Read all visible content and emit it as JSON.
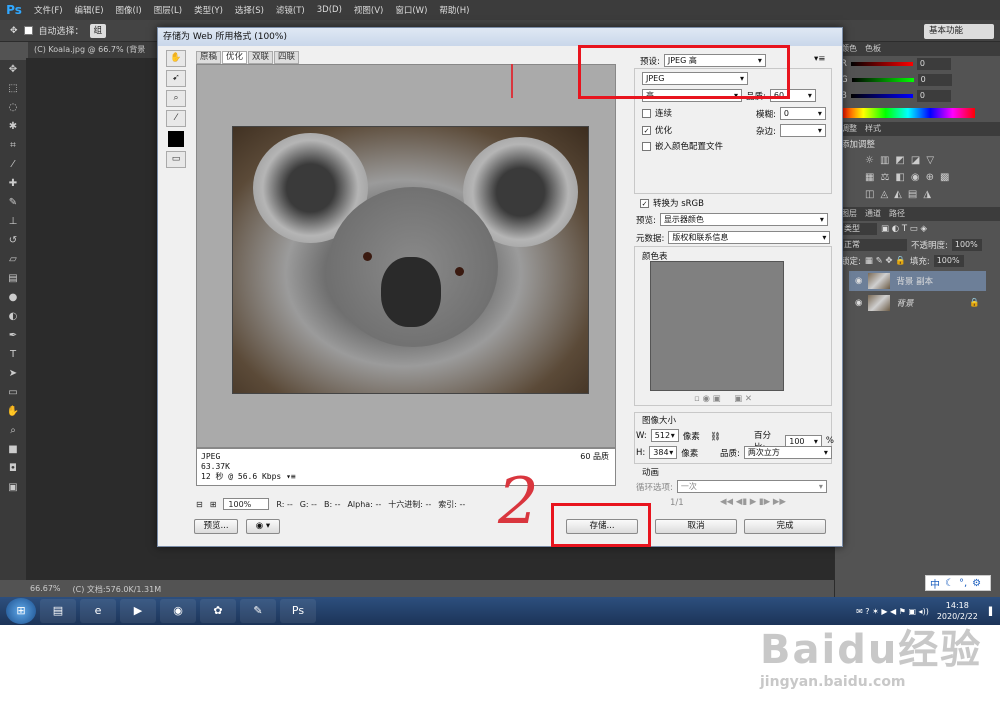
{
  "app": {
    "logo": "Ps"
  },
  "menu": [
    "文件(F)",
    "编辑(E)",
    "图像(I)",
    "图层(L)",
    "类型(Y)",
    "选择(S)",
    "滤镜(T)",
    "3D(D)",
    "视图(V)",
    "窗口(W)",
    "帮助(H)"
  ],
  "options_bar": {
    "auto_select_label": "自动选择：",
    "auto_select_value": "组",
    "workspace": "基本功能"
  },
  "doc_tab": "(C) Koala.jpg @ 66.7% (背景 副...",
  "status": {
    "zoom": "66.67%",
    "doc": "(C) 文档:576.0K/1.31M"
  },
  "dialog": {
    "title": "存储为 Web 所用格式 (100%)",
    "view_tabs": [
      "原稿",
      "优化",
      "双联",
      "四联"
    ],
    "active_tab": "优化",
    "preview_info": {
      "format": "JPEG",
      "size": "63.37K",
      "time": "12 秒 @ 56.6 Kbps",
      "menu_glyph": "▾≡",
      "quality": "60 品质"
    },
    "bottom_bar": {
      "zoom": "100%",
      "r": "R: --",
      "g": "G: --",
      "b": "B: --",
      "alpha": "Alpha: --",
      "hex": "十六进制: --",
      "index": "索引: --"
    },
    "buttons": {
      "preview": "预览...",
      "save": "存储...",
      "cancel": "取消",
      "done": "完成"
    },
    "settings": {
      "preset_label": "预设:",
      "preset_value": "JPEG 高",
      "format": "JPEG",
      "quality_level": "高",
      "quality_label": "品质:",
      "quality_value": "60",
      "progressive": "连续",
      "blur_label": "模糊:",
      "blur_value": "0",
      "optimized": "优化",
      "matte_label": "杂边:",
      "embed_profile": "嵌入颜色配置文件",
      "convert_srgb": "转换为 sRGB",
      "preview_label": "预览:",
      "preview_value": "显示器颜色",
      "metadata_label": "元数据:",
      "metadata_value": "版权和联系信息",
      "color_table_label": "颜色表",
      "image_size_label": "图像大小",
      "w_label": "W:",
      "w_value": "512",
      "h_label": "H:",
      "h_value": "384",
      "px": "像素",
      "percent_label": "百分比:",
      "percent_value": "100",
      "percent_unit": "%",
      "quality2_label": "品质:",
      "quality2_value": "两次立方",
      "animation_label": "动画",
      "loop_label": "循环选项:",
      "loop_value": "一次",
      "frame": "1/1"
    }
  },
  "right_panel": {
    "tabs_color": [
      "颜色",
      "色板"
    ],
    "rgb": [
      {
        "ch": "R",
        "val": "0"
      },
      {
        "ch": "G",
        "val": "0"
      },
      {
        "ch": "B",
        "val": "0"
      }
    ],
    "adjust_tabs": [
      "调整",
      "样式"
    ],
    "adjust_title": "添加调整",
    "layer_tabs": [
      "图层",
      "通道",
      "路径"
    ],
    "kind_label": "类型",
    "blend": "正常",
    "opacity_label": "不透明度:",
    "opacity": "100%",
    "lock_label": "锁定:",
    "fill_label": "填充:",
    "fill": "100%",
    "layers": [
      {
        "name": "背景 副本",
        "active": true
      },
      {
        "name": "背景",
        "active": false
      }
    ]
  },
  "ime": {
    "text": "中"
  },
  "taskbar": {
    "time": "14:18",
    "date": "2020/2/22"
  },
  "watermark": {
    "main": "Baidu经验",
    "sub": "jingyan.baidu.com"
  },
  "annotations": {
    "scribble": "2"
  },
  "colors": {
    "ps_bg": "#535353",
    "accent_red": "#e8141e",
    "layer_active": "#6d7f98"
  }
}
